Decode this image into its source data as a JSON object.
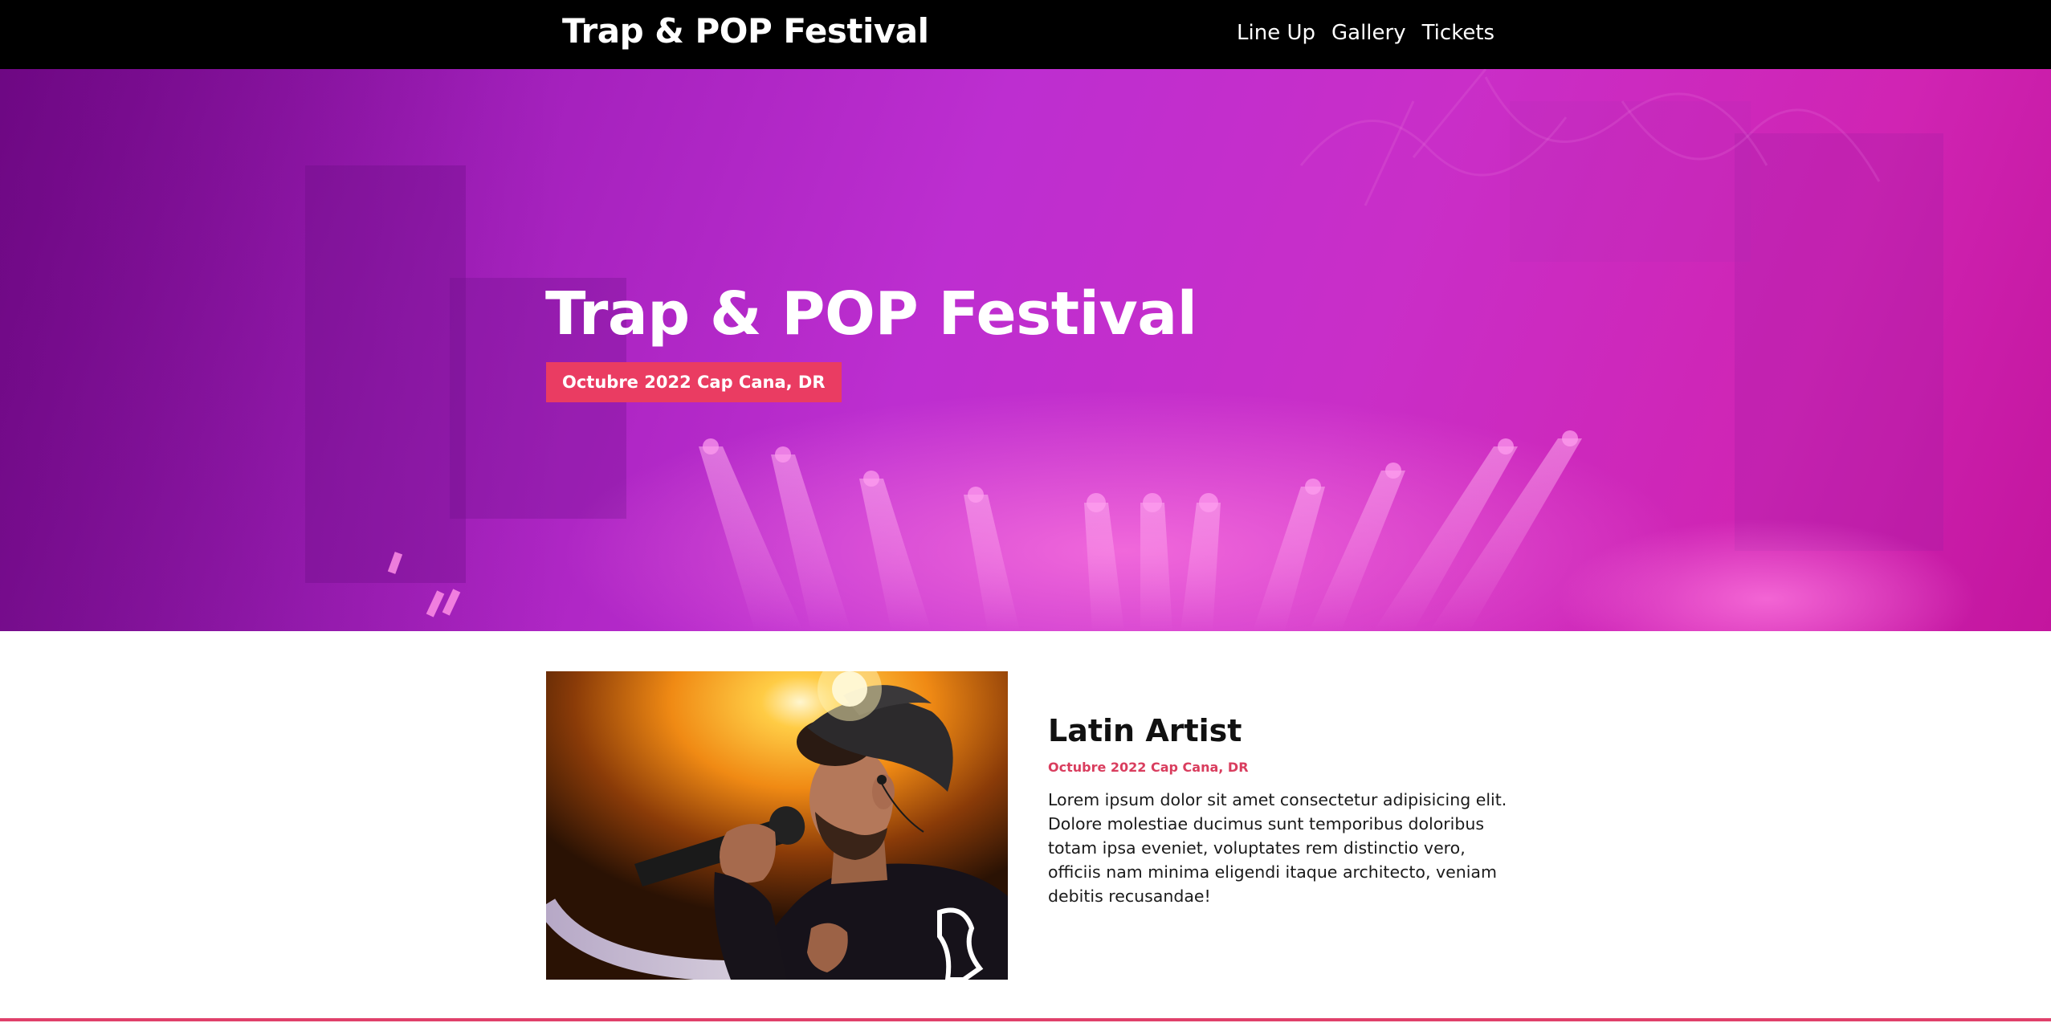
{
  "header": {
    "logo": "Trap & POP Festival",
    "nav": [
      {
        "label": "Line Up"
      },
      {
        "label": "Gallery"
      },
      {
        "label": "Tickets"
      }
    ]
  },
  "hero": {
    "title": "Trap & POP Festival",
    "badge": "Octubre 2022 Cap Cana, DR"
  },
  "artist": {
    "name": "Latin Artist",
    "date": "Octubre 2022 Cap Cana, DR",
    "description": "Lorem ipsum dolor sit amet consectetur adipisicing elit. Dolore molestiae ducimus sunt temporibus doloribus totam ipsa eveniet, voluptates rem distinctio vero, officiis nam minima eligendi itaque architecto, veniam debitis recusandae!"
  },
  "colors": {
    "header_bg": "#000000",
    "accent": "#ea3c62",
    "hero_purple": "#a11fba",
    "hero_pink": "#d024b3"
  }
}
